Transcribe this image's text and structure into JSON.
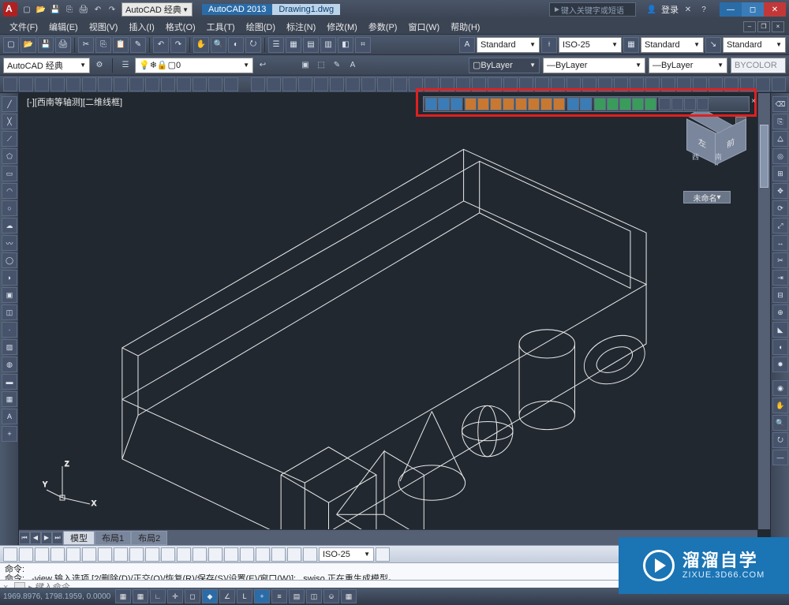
{
  "title": {
    "workspace_selector": "AutoCAD 经典",
    "app_name": "AutoCAD 2013",
    "doc_name": "Drawing1.dwg",
    "search_placeholder": "键入关键字或短语",
    "login": "登录"
  },
  "menu": [
    "文件(F)",
    "编辑(E)",
    "视图(V)",
    "插入(I)",
    "格式(O)",
    "工具(T)",
    "绘图(D)",
    "标注(N)",
    "修改(M)",
    "参数(P)",
    "窗口(W)",
    "帮助(H)"
  ],
  "styles_row": {
    "text_style": "Standard",
    "dim_style": "ISO-25",
    "table_style": "Standard",
    "mleader_style": "Standard"
  },
  "layers_row": {
    "workspace": "AutoCAD 经典",
    "layer_name": "0",
    "bylayer1": "ByLayer",
    "bylayer2": "ByLayer",
    "bylayer3": "ByLayer",
    "bycolor": "BYCOLOR"
  },
  "viewport_label": "[-][西南等轴测][二维线框]",
  "viewcube": {
    "face_left": "左",
    "face_front": "前",
    "dir_w": "西",
    "dir_s": "南",
    "unnamed": "未命名"
  },
  "tabs": {
    "model": "模型",
    "layout1": "布局1",
    "layout2": "布局2"
  },
  "dim_combo": "ISO-25",
  "command_history": {
    "line1": "命令:",
    "line2": "命令: _-view 输入选项 [?/删除(D)/正交(O)/恢复(R)/保存(S)/设置(E)/窗口(W)]: _swiso 正在重生成模型。"
  },
  "command_prompt": "键入命令",
  "status": {
    "coords": "1969.8976, 1798.1959, 0.0000"
  },
  "ucs": {
    "x": "X",
    "y": "Y",
    "z": "Z"
  },
  "watermark": {
    "cn": "溜溜自学",
    "en": "ZIXUE.3D66.COM"
  },
  "float_toolbar_count": 24
}
